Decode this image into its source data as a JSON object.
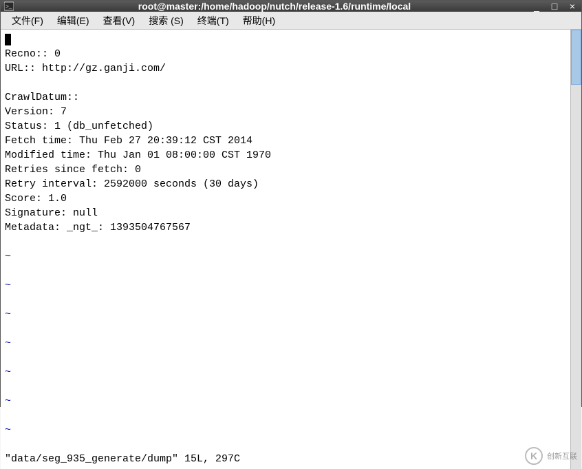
{
  "window": {
    "title": "root@master:/home/hadoop/nutch/release-1.6/runtime/local",
    "minimize_glyph": "_",
    "maximize_glyph": "□",
    "close_glyph": "×"
  },
  "menu": {
    "items": [
      {
        "label": "文件(F)"
      },
      {
        "label": "编辑(E)"
      },
      {
        "label": "查看(V)"
      },
      {
        "label": "搜索 (S)"
      },
      {
        "label": "终端(T)"
      },
      {
        "label": "帮助(H)"
      }
    ]
  },
  "terminal": {
    "lines": [
      "Recno:: 0",
      "URL:: http://gz.ganji.com/",
      "",
      "CrawlDatum::",
      "Version: 7",
      "Status: 1 (db_unfetched)",
      "Fetch time: Thu Feb 27 20:39:12 CST 2014",
      "Modified time: Thu Jan 01 08:00:00 CST 1970",
      "Retries since fetch: 0",
      "Retry interval: 2592000 seconds (30 days)",
      "Score: 1.0",
      "Signature: null",
      "Metadata: _ngt_: 1393504767567",
      ""
    ],
    "tilde_lines": 7,
    "tilde_char": "~",
    "status_line": "\"data/seg_935_generate/dump\" 15L, 297C"
  },
  "watermark": {
    "letter": "K",
    "text": "创新互联"
  }
}
